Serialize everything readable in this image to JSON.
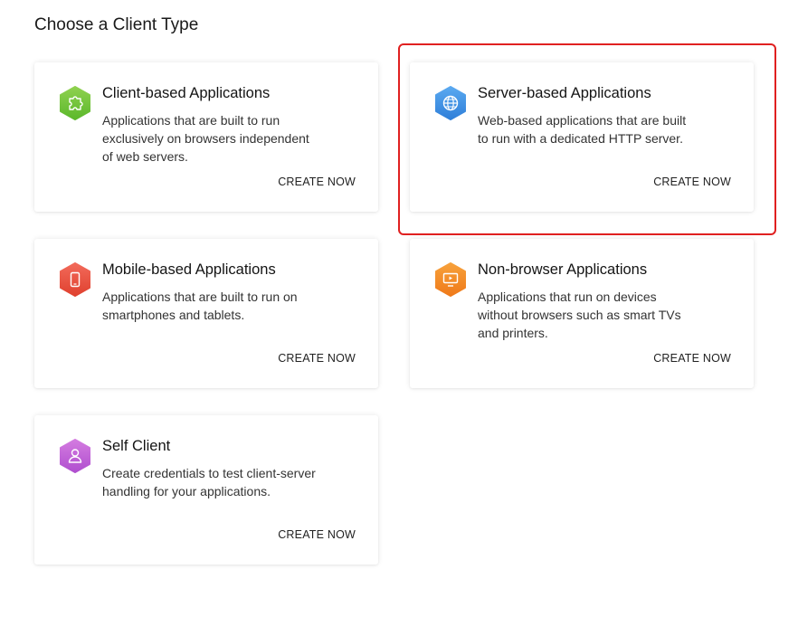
{
  "page": {
    "title": "Choose a Client Type"
  },
  "cards": [
    {
      "title": "Client-based Applications",
      "description": "Applications that are built to run exclusively on browsers independent of web servers.",
      "cta": "CREATE NOW",
      "icon": "puzzle-icon",
      "color_top": "#8fd14f",
      "color_bottom": "#5cb82c"
    },
    {
      "title": "Server-based Applications",
      "description": "Web-based applications that are built to run with a dedicated HTTP server.",
      "cta": "CREATE NOW",
      "icon": "globe-icon",
      "color_top": "#5aa9f0",
      "color_bottom": "#2f7fd9",
      "highlighted": true
    },
    {
      "title": "Mobile-based Applications",
      "description": "Applications that are built to run on smartphones and tablets.",
      "cta": "CREATE NOW",
      "icon": "smartphone-icon",
      "color_top": "#f26a5a",
      "color_bottom": "#e0412f"
    },
    {
      "title": "Non-browser Applications",
      "description": "Applications that run on devices without browsers such as smart TVs and printers.",
      "cta": "CREATE NOW",
      "icon": "monitor-icon",
      "color_top": "#f7a13b",
      "color_bottom": "#ef7a1a"
    },
    {
      "title": "Self Client",
      "description": "Create credentials to test client-server handling for your applications.",
      "cta": "CREATE NOW",
      "icon": "user-icon",
      "color_top": "#d47be0",
      "color_bottom": "#b04fcf"
    }
  ],
  "highlight_color": "#e02020"
}
